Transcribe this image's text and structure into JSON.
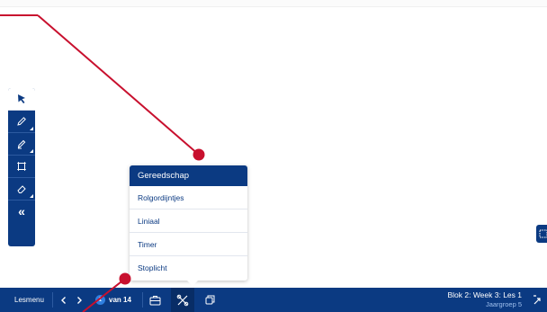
{
  "colors": {
    "brand_blue": "#0b3a82",
    "annotation_red": "#c8102e",
    "page_badge": "#2f7fe0"
  },
  "toolbar": {
    "tools": [
      {
        "name": "select-arrow-icon",
        "active": true
      },
      {
        "name": "pen-icon",
        "active": false
      },
      {
        "name": "marker-icon",
        "active": false
      },
      {
        "name": "frame-icon",
        "active": false
      },
      {
        "name": "eraser-icon",
        "active": false
      },
      {
        "name": "collapse-icon",
        "label": "«"
      }
    ]
  },
  "popup": {
    "title": "Gereedschap",
    "items": [
      "Rolgordijntjes",
      "Liniaal",
      "Timer",
      "Stoplicht"
    ]
  },
  "bottombar": {
    "menu_label": "Lesmenu",
    "prev_icon": "chevron-left-icon",
    "next_icon": "chevron-right-icon",
    "current_page": "1",
    "page_total": "van 14",
    "briefcase_icon": "briefcase-icon",
    "tools_icon": "tools-icon",
    "copy_icon": "copy-icon",
    "lesson_title": "Blok 2: Week 3: Les 1",
    "lesson_sub": "Jaargroep 5",
    "fullscreen_icon": "fullscreen-icon"
  }
}
